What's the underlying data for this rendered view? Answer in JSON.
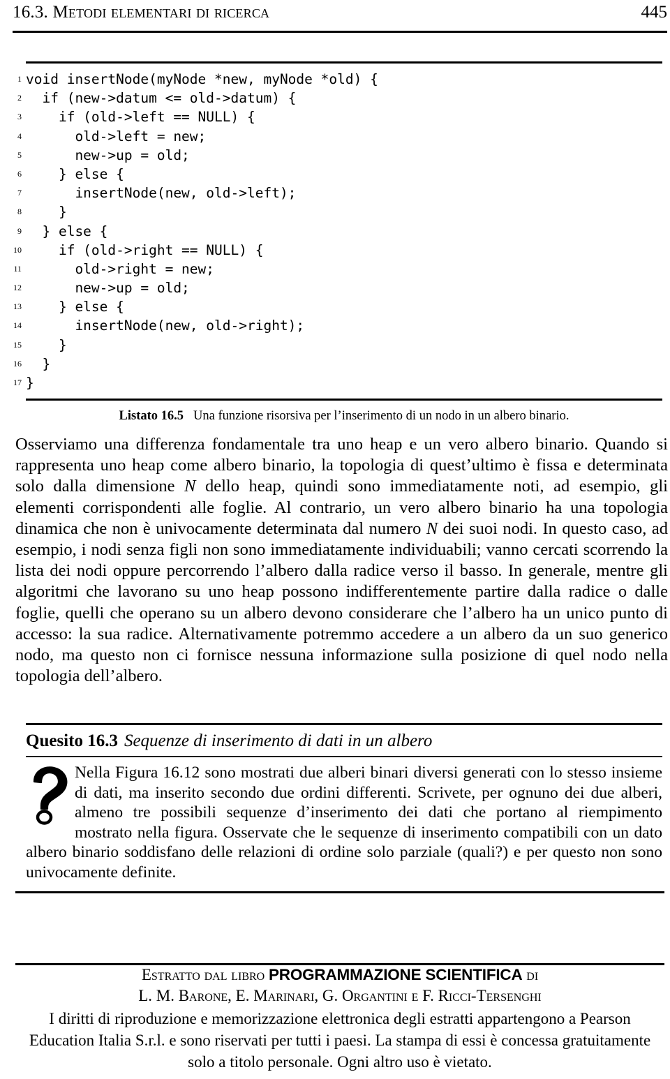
{
  "running_head": {
    "title": "16.3.  Metodi elementari di ricerca",
    "page_number": "445"
  },
  "listing": {
    "lines": [
      {
        "n": "1",
        "text": "void insertNode(myNode *new, myNode *old) {"
      },
      {
        "n": "2",
        "text": "  if (new->datum <= old->datum) {"
      },
      {
        "n": "3",
        "text": "    if (old->left == NULL) {"
      },
      {
        "n": "4",
        "text": "      old->left = new;"
      },
      {
        "n": "5",
        "text": "      new->up = old;"
      },
      {
        "n": "6",
        "text": "    } else {"
      },
      {
        "n": "7",
        "text": "      insertNode(new, old->left);"
      },
      {
        "n": "8",
        "text": "    }"
      },
      {
        "n": "9",
        "text": "  } else {"
      },
      {
        "n": "10",
        "text": "    if (old->right == NULL) {"
      },
      {
        "n": "11",
        "text": "      old->right = new;"
      },
      {
        "n": "12",
        "text": "      new->up = old;"
      },
      {
        "n": "13",
        "text": "    } else {"
      },
      {
        "n": "14",
        "text": "      insertNode(new, old->right);"
      },
      {
        "n": "15",
        "text": "    }"
      },
      {
        "n": "16",
        "text": "  }"
      },
      {
        "n": "17",
        "text": "}"
      }
    ],
    "caption_label": "Listato 16.5",
    "caption_text": "Una funzione risorsiva per l’inserimento di un nodo in un albero binario."
  },
  "body": {
    "paragraph_part1": "Osserviamo una differenza fondamentale tra uno heap e un vero albero binario. Quando si rappresenta uno heap come albero binario, la topologia di quest’ultimo è fissa e determinata solo dalla dimensione ",
    "math_n_1": "N",
    "paragraph_part2": " dello heap, quindi sono immediatamente noti, ad esempio, gli elementi corrispondenti alle foglie. Al contrario, un vero albero binario ha una topologia dinamica che non è univocamente determinata dal numero ",
    "math_n_2": "N",
    "paragraph_part3": " dei suoi nodi. In questo caso, ad esempio, i nodi senza figli non sono immediatamente individuabili; vanno cercati scorrendo la lista dei nodi oppure percorrendo l’albero dalla radice verso il basso. In generale, mentre gli algoritmi che lavorano su uno heap possono indifferentemente partire dalla radice o dalle foglie, quelli che operano su un albero devono considerare che l’albero ha un unico punto di accesso: la sua radice. Alternativamente potremmo accedere a un albero da un suo generico nodo, ma questo non ci fornisce nessuna informazione sulla posizione di quel nodo nella topologia dell’albero."
  },
  "quesito": {
    "label": "Quesito 16.3",
    "title": "Sequenze di inserimento di dati in un albero",
    "icon": "question-mark-icon",
    "text": "Nella Figura 16.12 sono mostrati due alberi binari diversi generati con lo stesso insieme di dati, ma inserito secondo due ordini differenti. Scrivete, per ognuno dei due alberi, almeno tre possibili sequenze d’inserimento dei dati che portano al riempimento mostrato nella figura. Osservate che le sequenze di inserimento compatibili con un dato albero binario soddisfano delle relazioni di ordine solo parziale (quali?) e per questo non sono univocamente definite."
  },
  "footer": {
    "line1_pre": "Estratto dal libro ",
    "line1_book": "PROGRAMMAZIONE SCIENTIFICA",
    "line1_post": " di",
    "line2": "L. M. Barone, E. Marinari, G. Organtini e F. Ricci-Tersenghi",
    "legal": "I diritti di riproduzione e memorizzazione elettronica degli estratti appartengono a Pearson Education Italia S.r.l. e sono riservati per tutti i paesi. La stampa di essi è concessa gratuitamente solo a titolo personale. Ogni altro uso è vietato."
  },
  "colors": {
    "text": "#000000",
    "background": "#ffffff",
    "rule": "#000000"
  }
}
